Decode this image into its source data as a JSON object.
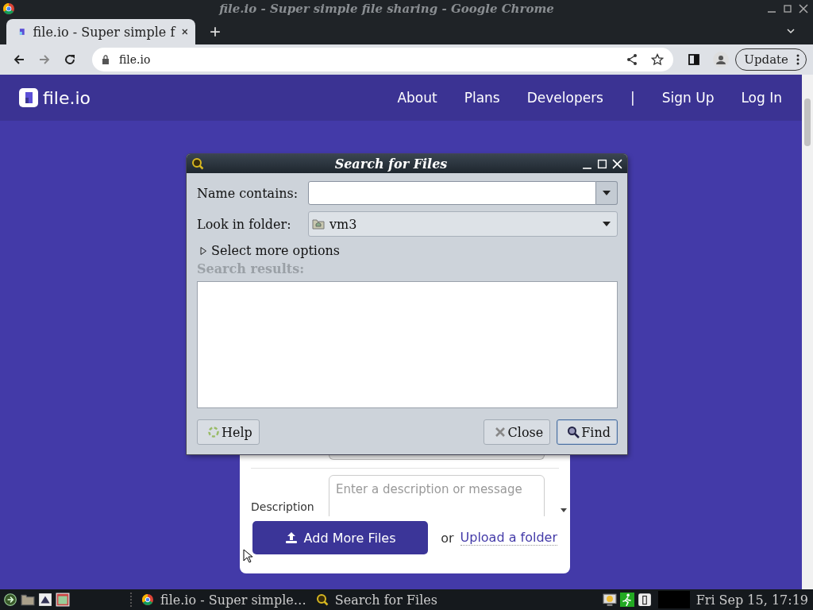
{
  "window": {
    "title": "file.io - Super simple file sharing - Google Chrome"
  },
  "tabs": [
    {
      "label": "file.io - Super simple f",
      "selected": true
    }
  ],
  "address_bar": {
    "url": "file.io"
  },
  "update_button": "Update",
  "site": {
    "logo": "file.io",
    "nav": [
      "About",
      "Plans",
      "Developers",
      "|",
      "Sign Up",
      "Log In"
    ]
  },
  "upload_card": {
    "description_label": "Description",
    "description_placeholder": "Enter a description or message",
    "add_button": "Add More Files",
    "or": "or",
    "folder_link": "Upload a folder"
  },
  "dialog": {
    "title": "Search for Files",
    "name_label": "Name contains:",
    "folder_label": "Look in folder:",
    "folder_value": "vm3",
    "more_options": "Select more options",
    "more_expanded": false,
    "results_label": "Search results:",
    "buttons": [
      {
        "kind": "help",
        "label": "Help",
        "selected": false
      },
      {
        "kind": "close",
        "label": "Close",
        "selected": false
      },
      {
        "kind": "find",
        "label": "Find",
        "selected": true
      }
    ]
  },
  "taskbar": {
    "tasks": [
      {
        "kind": "chrome",
        "label": "file.io - Super simple…"
      },
      {
        "kind": "search",
        "label": "Search for Files"
      }
    ],
    "clock": "Fri Sep 15, 17:19"
  }
}
